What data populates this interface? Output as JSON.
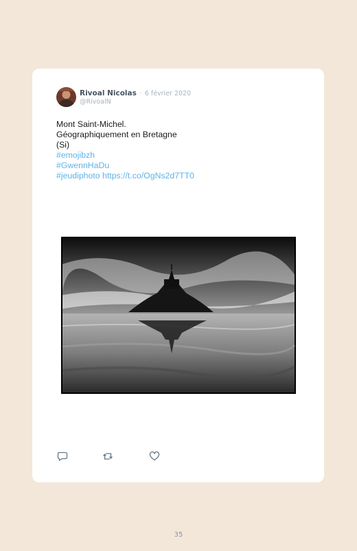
{
  "tweet": {
    "author_name": "Rivoal Nicolas",
    "separator": "·",
    "date": "6 février 2020",
    "handle": "@RivoalN",
    "lines": [
      "Mont Saint-Michel.",
      "Géographiquement en Bretagne",
      "(Si)"
    ],
    "hashtags": [
      "#emojibzh",
      "#GwennHaDu",
      "#jeudiphoto"
    ],
    "url": "https://t.co/OgNs2d7TT0",
    "link_color": "#5fb2e8",
    "image_subject": "mont-saint-michel-photo"
  },
  "actions": {
    "reply_icon": "reply-icon",
    "retweet_icon": "retweet-icon",
    "like_icon": "heart-icon"
  },
  "page": {
    "number": "35",
    "background": "#f3e7da"
  }
}
